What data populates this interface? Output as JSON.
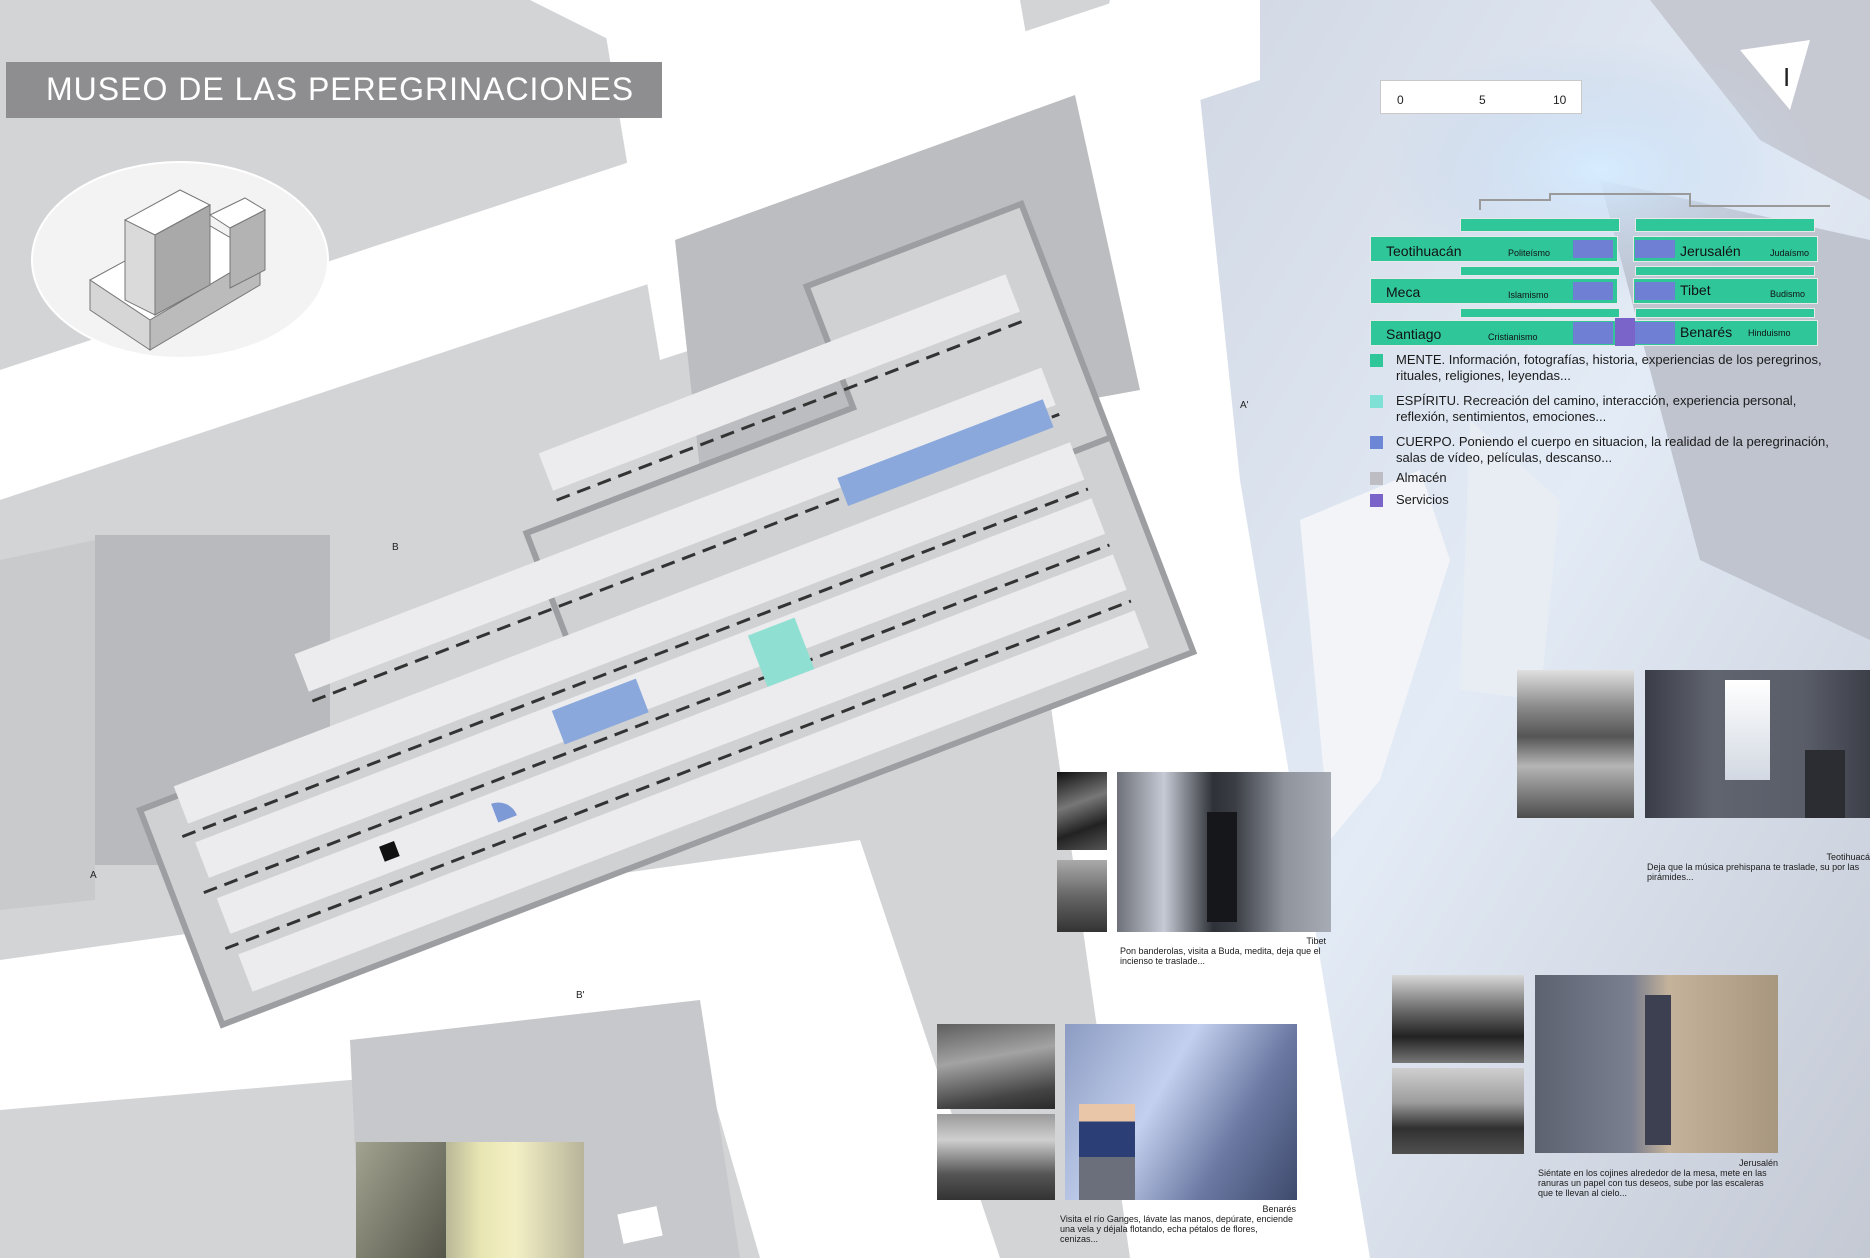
{
  "title": "MUSEO DE LAS PEREGRINACIONES",
  "north_arrow": "I",
  "scale_bar": {
    "ticks": [
      "0",
      "5",
      "10"
    ]
  },
  "section_markers": [
    "A",
    "A'",
    "B",
    "B'"
  ],
  "programs": [
    {
      "name": "Teotihuacán",
      "religion": "Politeísmo"
    },
    {
      "name": "Meca",
      "religion": "Islamismo"
    },
    {
      "name": "Santiago",
      "religion": "Cristianismo"
    },
    {
      "name": "Jerusalén",
      "religion": "Judaísmo"
    },
    {
      "name": "Tibet",
      "religion": "Budismo"
    },
    {
      "name": "Benarés",
      "religion": "Hinduismo"
    }
  ],
  "legend": [
    {
      "text": "MENTE. Información, fotografías, historia, experiencias de los peregrinos, rituales, religiones, leyendas...",
      "color": "#2fc79a"
    },
    {
      "text": "ESPÍRITU. Recreación del camino, interacción, experiencia personal, reflexión, sentimientos, emociones...",
      "color": "#7fe0d6"
    },
    {
      "text": "CUERPO. Poniendo el cuerpo en situacion, la realidad de la peregrinación, salas de vídeo, películas, descanso...",
      "color": "#6e86d6"
    },
    {
      "text": "Almacén",
      "color": "#bdbdc3"
    },
    {
      "text": "Servicios",
      "color": "#7a63c9"
    }
  ],
  "captions": {
    "tibet": {
      "name": "Tibet",
      "text": "Pon banderolas, visita a Buda, medita, deja que el incienso te traslade..."
    },
    "benares": {
      "name": "Benarés",
      "text": "Visita el río Ganges, lávate las manos, depúrate, enciende una vela y déjala flotando, echa pétalos de flores, cenizas..."
    },
    "teotihuacan": {
      "name": "Teotihuacá",
      "text": "Deja que la música prehispana te traslade, su por las pirámides..."
    },
    "jerusalen": {
      "name": "Jerusalén",
      "text": "Siéntate en los cojines alrededor de la mesa, mete en las ranuras un papel con tus deseos, sube por las escaleras que te llevan al cielo..."
    }
  }
}
